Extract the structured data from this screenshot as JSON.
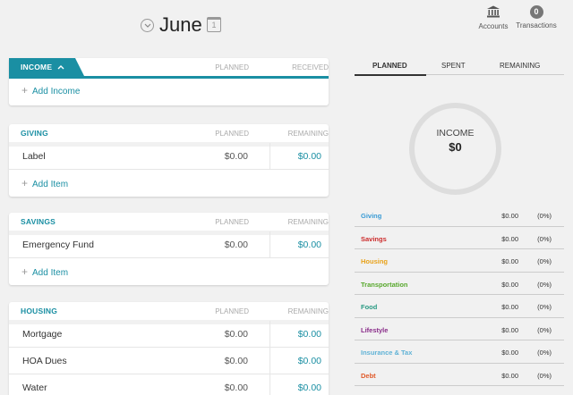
{
  "header": {
    "month": "June",
    "calendar_day": "1",
    "accounts_label": "Accounts",
    "transactions_label": "Transactions",
    "transactions_count": "0"
  },
  "income": {
    "tab_label": "INCOME",
    "col_planned": "PLANNED",
    "col_received": "RECEIVED",
    "add_label": "Add Income"
  },
  "giving": {
    "tab_label": "GIVING",
    "col_planned": "PLANNED",
    "col_remaining": "REMAINING",
    "rows": [
      {
        "label": "Label",
        "planned": "$0.00",
        "remaining": "$0.00"
      }
    ],
    "add_label": "Add Item"
  },
  "savings": {
    "tab_label": "SAVINGS",
    "col_planned": "PLANNED",
    "col_remaining": "REMAINING",
    "rows": [
      {
        "label": "Emergency Fund",
        "planned": "$0.00",
        "remaining": "$0.00"
      }
    ],
    "add_label": "Add Item"
  },
  "housing": {
    "tab_label": "HOUSING",
    "col_planned": "PLANNED",
    "col_remaining": "REMAINING",
    "rows": [
      {
        "label": "Mortgage",
        "planned": "$0.00",
        "remaining": "$0.00"
      },
      {
        "label": "HOA Dues",
        "planned": "$0.00",
        "remaining": "$0.00"
      },
      {
        "label": "Water",
        "planned": "$0.00",
        "remaining": "$0.00"
      }
    ]
  },
  "summary": {
    "tabs": [
      "PLANNED",
      "SPENT",
      "REMAINING"
    ],
    "active_tab": "PLANNED",
    "donut_label": "INCOME",
    "donut_value": "$0",
    "categories": [
      {
        "name": "Giving",
        "amount": "$0.00",
        "percent": "(0%)",
        "color": "#3a9bd5"
      },
      {
        "name": "Savings",
        "amount": "$0.00",
        "percent": "(0%)",
        "color": "#cc2b2b"
      },
      {
        "name": "Housing",
        "amount": "$0.00",
        "percent": "(0%)",
        "color": "#e8a21a"
      },
      {
        "name": "Transportation",
        "amount": "$0.00",
        "percent": "(0%)",
        "color": "#58a82d"
      },
      {
        "name": "Food",
        "amount": "$0.00",
        "percent": "(0%)",
        "color": "#2a9a83"
      },
      {
        "name": "Lifestyle",
        "amount": "$0.00",
        "percent": "(0%)",
        "color": "#8a2d8a"
      },
      {
        "name": "Insurance & Tax",
        "amount": "$0.00",
        "percent": "(0%)",
        "color": "#5fb2d6"
      },
      {
        "name": "Debt",
        "amount": "$0.00",
        "percent": "(0%)",
        "color": "#e05a2a"
      }
    ]
  },
  "colors": {
    "accent": "#1a8fa3",
    "background": "#f1f1f1"
  },
  "icons": [
    "chevron-down-icon",
    "calendar-icon",
    "bank-icon",
    "chevron-up-icon",
    "plus-icon"
  ]
}
